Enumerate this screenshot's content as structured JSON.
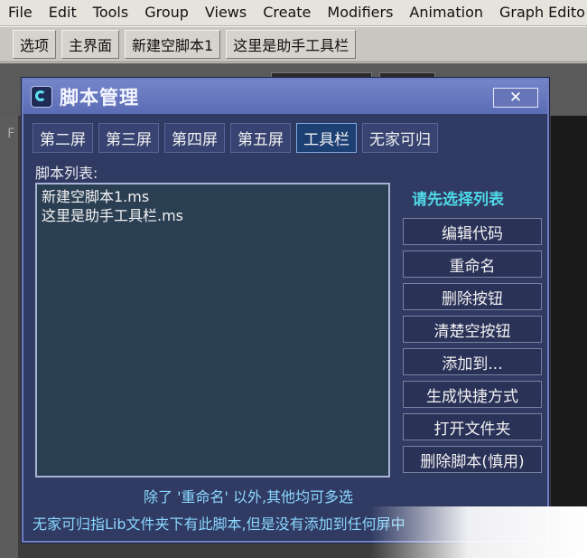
{
  "menubar": {
    "items": [
      {
        "label": "File"
      },
      {
        "label": "Edit"
      },
      {
        "label": "Tools"
      },
      {
        "label": "Group"
      },
      {
        "label": "Views"
      },
      {
        "label": "Create"
      },
      {
        "label": "Modifiers"
      },
      {
        "label": "Animation"
      },
      {
        "label": "Graph Edito"
      }
    ]
  },
  "toolbar2": {
    "buttons": [
      {
        "label": "选项"
      },
      {
        "label": "主界面"
      },
      {
        "label": "新建空脚本1"
      },
      {
        "label": "这里是助手工具栏"
      }
    ]
  },
  "background": {
    "left_char": "F"
  },
  "dialog": {
    "title": "脚本管理",
    "close_label": "✕",
    "tabs": [
      {
        "label": "第二屏",
        "active": false
      },
      {
        "label": "第三屏",
        "active": false
      },
      {
        "label": "第四屏",
        "active": false
      },
      {
        "label": "第五屏",
        "active": false
      },
      {
        "label": "工具栏",
        "active": true
      },
      {
        "label": "无家可归",
        "active": false
      }
    ],
    "list_label": "脚本列表:",
    "scripts": [
      {
        "name": "新建空脚本1.ms"
      },
      {
        "name": "这里是助手工具栏.ms"
      }
    ],
    "hint": "请先选择列表",
    "buttons": [
      {
        "label": "编辑代码"
      },
      {
        "label": "重命名"
      },
      {
        "label": "删除按钮"
      },
      {
        "label": "清楚空按钮"
      },
      {
        "label": "添加到..."
      },
      {
        "label": "生成快捷方式"
      },
      {
        "label": "打开文件夹"
      },
      {
        "label": "删除脚本(慎用)"
      }
    ],
    "note1": "除了 '重命名' 以外,其他均可多选",
    "note2": "无家可归指Lib文件夹下有此脚本,但是没有添加到任何屏中"
  },
  "colors": {
    "dialog_bg": "#303a62",
    "titlebar": "#6474bd",
    "accent_cyan": "#4fd8e6",
    "note_blue": "#8bd8ff",
    "list_bg": "#2b3f52"
  }
}
